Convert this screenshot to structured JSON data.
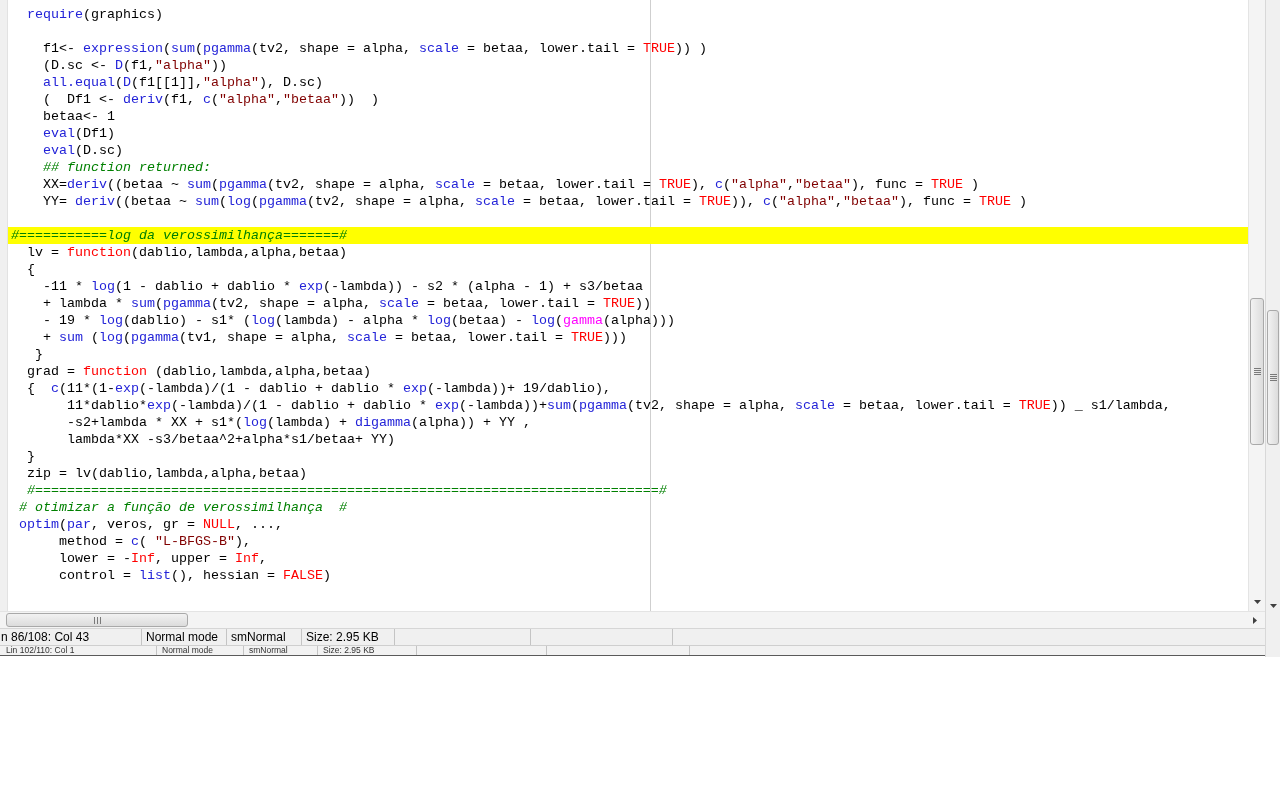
{
  "editor": {
    "lines": [
      {
        "kind": "code",
        "highlighted": false,
        "segments": [
          {
            "kind": "function",
            "text": "  require"
          },
          {
            "kind": "plain",
            "text": "(graphics)"
          }
        ]
      },
      {
        "kind": "blank",
        "highlighted": false
      },
      {
        "kind": "code",
        "highlighted": false,
        "segments": [
          {
            "kind": "plain",
            "text": "    f1<- "
          },
          {
            "kind": "function",
            "text": "expression"
          },
          {
            "kind": "plain",
            "text": "("
          },
          {
            "kind": "function",
            "text": "sum"
          },
          {
            "kind": "plain",
            "text": "("
          },
          {
            "kind": "function",
            "text": "pgamma"
          },
          {
            "kind": "plain",
            "text": "(tv2, shape = alpha, "
          },
          {
            "kind": "function",
            "text": "scale"
          },
          {
            "kind": "plain",
            "text": " = betaa, lower.tail = "
          },
          {
            "kind": "constant",
            "text": "TRUE"
          },
          {
            "kind": "plain",
            "text": ")) )"
          }
        ]
      },
      {
        "kind": "code",
        "highlighted": false,
        "segments": [
          {
            "kind": "plain",
            "text": "    (D.sc <- "
          },
          {
            "kind": "function",
            "text": "D"
          },
          {
            "kind": "plain",
            "text": "(f1,"
          },
          {
            "kind": "string",
            "text": "\"alpha\""
          },
          {
            "kind": "plain",
            "text": "))"
          }
        ]
      },
      {
        "kind": "code",
        "highlighted": false,
        "segments": [
          {
            "kind": "function",
            "text": "    all.equal"
          },
          {
            "kind": "plain",
            "text": "("
          },
          {
            "kind": "function",
            "text": "D"
          },
          {
            "kind": "plain",
            "text": "(f1[[1]],"
          },
          {
            "kind": "string",
            "text": "\"alpha\""
          },
          {
            "kind": "plain",
            "text": "), D.sc)"
          }
        ]
      },
      {
        "kind": "code",
        "highlighted": false,
        "segments": [
          {
            "kind": "plain",
            "text": "    (  Df1 <- "
          },
          {
            "kind": "function",
            "text": "deriv"
          },
          {
            "kind": "plain",
            "text": "(f1, "
          },
          {
            "kind": "function",
            "text": "c"
          },
          {
            "kind": "plain",
            "text": "("
          },
          {
            "kind": "string",
            "text": "\"alpha\""
          },
          {
            "kind": "plain",
            "text": ","
          },
          {
            "kind": "string",
            "text": "\"betaa\""
          },
          {
            "kind": "plain",
            "text": "))  )"
          }
        ]
      },
      {
        "kind": "code",
        "highlighted": false,
        "segments": [
          {
            "kind": "plain",
            "text": "    betaa<- 1"
          }
        ]
      },
      {
        "kind": "code",
        "highlighted": false,
        "segments": [
          {
            "kind": "function",
            "text": "    eval"
          },
          {
            "kind": "plain",
            "text": "(Df1)"
          }
        ]
      },
      {
        "kind": "code",
        "highlighted": false,
        "segments": [
          {
            "kind": "function",
            "text": "    eval"
          },
          {
            "kind": "plain",
            "text": "(D.sc)"
          }
        ]
      },
      {
        "kind": "code",
        "highlighted": false,
        "segments": [
          {
            "kind": "comment",
            "text": "    ## function returned:"
          }
        ]
      },
      {
        "kind": "code",
        "highlighted": false,
        "segments": [
          {
            "kind": "plain",
            "text": "    XX="
          },
          {
            "kind": "function",
            "text": "deriv"
          },
          {
            "kind": "plain",
            "text": "((betaa ~ "
          },
          {
            "kind": "function",
            "text": "sum"
          },
          {
            "kind": "plain",
            "text": "("
          },
          {
            "kind": "function",
            "text": "pgamma"
          },
          {
            "kind": "plain",
            "text": "(tv2, shape = alpha, "
          },
          {
            "kind": "function",
            "text": "scale"
          },
          {
            "kind": "plain",
            "text": " = betaa, lower.tail = "
          },
          {
            "kind": "constant",
            "text": "TRUE"
          },
          {
            "kind": "plain",
            "text": "), "
          },
          {
            "kind": "function",
            "text": "c"
          },
          {
            "kind": "plain",
            "text": "("
          },
          {
            "kind": "string",
            "text": "\"alpha\""
          },
          {
            "kind": "plain",
            "text": ","
          },
          {
            "kind": "string",
            "text": "\"betaa\""
          },
          {
            "kind": "plain",
            "text": "), func = "
          },
          {
            "kind": "constant",
            "text": "TRUE"
          },
          {
            "kind": "plain",
            "text": " )"
          }
        ]
      },
      {
        "kind": "code",
        "highlighted": false,
        "segments": [
          {
            "kind": "plain",
            "text": "    YY= "
          },
          {
            "kind": "function",
            "text": "deriv"
          },
          {
            "kind": "plain",
            "text": "((betaa ~ "
          },
          {
            "kind": "function",
            "text": "sum"
          },
          {
            "kind": "plain",
            "text": "("
          },
          {
            "kind": "function",
            "text": "log"
          },
          {
            "kind": "plain",
            "text": "("
          },
          {
            "kind": "function",
            "text": "pgamma"
          },
          {
            "kind": "plain",
            "text": "(tv2, shape = alpha, "
          },
          {
            "kind": "function",
            "text": "scale"
          },
          {
            "kind": "plain",
            "text": " = betaa, lower.tail = "
          },
          {
            "kind": "constant",
            "text": "TRUE"
          },
          {
            "kind": "plain",
            "text": ")), "
          },
          {
            "kind": "function",
            "text": "c"
          },
          {
            "kind": "plain",
            "text": "("
          },
          {
            "kind": "string",
            "text": "\"alpha\""
          },
          {
            "kind": "plain",
            "text": ","
          },
          {
            "kind": "string",
            "text": "\"betaa\""
          },
          {
            "kind": "plain",
            "text": "), func = "
          },
          {
            "kind": "constant",
            "text": "TRUE"
          },
          {
            "kind": "plain",
            "text": " )"
          }
        ]
      },
      {
        "kind": "blank",
        "highlighted": false
      },
      {
        "kind": "code",
        "highlighted": true,
        "segments": [
          {
            "kind": "comment",
            "text": "#===========log da verossimilhança=======#"
          }
        ]
      },
      {
        "kind": "code",
        "highlighted": false,
        "segments": [
          {
            "kind": "plain",
            "text": "  lv = "
          },
          {
            "kind": "constant",
            "text": "function"
          },
          {
            "kind": "plain",
            "text": "(dablio,lambda,alpha,betaa)"
          }
        ]
      },
      {
        "kind": "code",
        "highlighted": false,
        "segments": [
          {
            "kind": "plain",
            "text": "  {"
          }
        ]
      },
      {
        "kind": "code",
        "highlighted": false,
        "segments": [
          {
            "kind": "plain",
            "text": "    -11 * "
          },
          {
            "kind": "function",
            "text": "log"
          },
          {
            "kind": "plain",
            "text": "(1 - dablio + dablio * "
          },
          {
            "kind": "function",
            "text": "exp"
          },
          {
            "kind": "plain",
            "text": "(-lambda)) - s2 * (alpha - 1) + s3/betaa"
          }
        ]
      },
      {
        "kind": "code",
        "highlighted": false,
        "segments": [
          {
            "kind": "plain",
            "text": "    + lambda * "
          },
          {
            "kind": "function",
            "text": "sum"
          },
          {
            "kind": "plain",
            "text": "("
          },
          {
            "kind": "function",
            "text": "pgamma"
          },
          {
            "kind": "plain",
            "text": "(tv2, shape = alpha, "
          },
          {
            "kind": "function",
            "text": "scale"
          },
          {
            "kind": "plain",
            "text": " = betaa, lower.tail = "
          },
          {
            "kind": "constant",
            "text": "TRUE"
          },
          {
            "kind": "plain",
            "text": "))"
          }
        ]
      },
      {
        "kind": "code",
        "highlighted": false,
        "segments": [
          {
            "kind": "plain",
            "text": "    - 19 * "
          },
          {
            "kind": "function",
            "text": "log"
          },
          {
            "kind": "plain",
            "text": "(dablio) - s1* ("
          },
          {
            "kind": "function",
            "text": "log"
          },
          {
            "kind": "plain",
            "text": "(lambda) - alpha * "
          },
          {
            "kind": "function",
            "text": "log"
          },
          {
            "kind": "plain",
            "text": "(betaa) - "
          },
          {
            "kind": "function",
            "text": "log"
          },
          {
            "kind": "plain",
            "text": "("
          },
          {
            "kind": "special",
            "text": "gamma"
          },
          {
            "kind": "plain",
            "text": "(alpha)))"
          }
        ]
      },
      {
        "kind": "code",
        "highlighted": false,
        "segments": [
          {
            "kind": "plain",
            "text": "    + "
          },
          {
            "kind": "function",
            "text": "sum"
          },
          {
            "kind": "plain",
            "text": " ("
          },
          {
            "kind": "function",
            "text": "log"
          },
          {
            "kind": "plain",
            "text": "("
          },
          {
            "kind": "function",
            "text": "pgamma"
          },
          {
            "kind": "plain",
            "text": "(tv1, shape = alpha, "
          },
          {
            "kind": "function",
            "text": "scale"
          },
          {
            "kind": "plain",
            "text": " = betaa, lower.tail = "
          },
          {
            "kind": "constant",
            "text": "TRUE"
          },
          {
            "kind": "plain",
            "text": ")))"
          }
        ]
      },
      {
        "kind": "code",
        "highlighted": false,
        "segments": [
          {
            "kind": "plain",
            "text": "   }"
          }
        ]
      },
      {
        "kind": "code",
        "highlighted": false,
        "segments": [
          {
            "kind": "plain",
            "text": "  grad = "
          },
          {
            "kind": "constant",
            "text": "function"
          },
          {
            "kind": "plain",
            "text": " (dablio,lambda,alpha,betaa)"
          }
        ]
      },
      {
        "kind": "code",
        "highlighted": false,
        "segments": [
          {
            "kind": "plain",
            "text": "  {  "
          },
          {
            "kind": "function",
            "text": "c"
          },
          {
            "kind": "plain",
            "text": "(11*(1-"
          },
          {
            "kind": "function",
            "text": "exp"
          },
          {
            "kind": "plain",
            "text": "(-lambda)/(1 - dablio + dablio * "
          },
          {
            "kind": "function",
            "text": "exp"
          },
          {
            "kind": "plain",
            "text": "(-lambda))+ 19/dablio),"
          }
        ]
      },
      {
        "kind": "code",
        "highlighted": false,
        "segments": [
          {
            "kind": "plain",
            "text": "       11*dablio*"
          },
          {
            "kind": "function",
            "text": "exp"
          },
          {
            "kind": "plain",
            "text": "(-lambda)/(1 - dablio + dablio * "
          },
          {
            "kind": "function",
            "text": "exp"
          },
          {
            "kind": "plain",
            "text": "(-lambda))+"
          },
          {
            "kind": "function",
            "text": "sum"
          },
          {
            "kind": "plain",
            "text": "("
          },
          {
            "kind": "function",
            "text": "pgamma"
          },
          {
            "kind": "plain",
            "text": "(tv2, shape = alpha, "
          },
          {
            "kind": "function",
            "text": "scale"
          },
          {
            "kind": "plain",
            "text": " = betaa, lower.tail = "
          },
          {
            "kind": "constant",
            "text": "TRUE"
          },
          {
            "kind": "plain",
            "text": ")) _ s1/lambda,"
          }
        ]
      },
      {
        "kind": "code",
        "highlighted": false,
        "segments": [
          {
            "kind": "plain",
            "text": "       -s2+lambda * XX + s1*("
          },
          {
            "kind": "function",
            "text": "log"
          },
          {
            "kind": "plain",
            "text": "(lambda) + "
          },
          {
            "kind": "function",
            "text": "digamma"
          },
          {
            "kind": "plain",
            "text": "(alpha)) + YY ,"
          }
        ]
      },
      {
        "kind": "code",
        "highlighted": false,
        "segments": [
          {
            "kind": "plain",
            "text": "       lambda*XX -s3/betaa^2+alpha*s1/betaa+ YY)"
          }
        ]
      },
      {
        "kind": "code",
        "highlighted": false,
        "segments": [
          {
            "kind": "plain",
            "text": "  }"
          }
        ]
      },
      {
        "kind": "code",
        "highlighted": false,
        "segments": [
          {
            "kind": "plain",
            "text": "  zip = lv(dablio,lambda,alpha,betaa)"
          }
        ]
      },
      {
        "kind": "code",
        "highlighted": false,
        "segments": [
          {
            "kind": "comment",
            "text": "  #==============================================================================#"
          }
        ]
      },
      {
        "kind": "code",
        "highlighted": false,
        "segments": [
          {
            "kind": "comment",
            "text": " # otimizar a função de verossimilhança  #"
          }
        ]
      },
      {
        "kind": "code",
        "highlighted": false,
        "segments": [
          {
            "kind": "function",
            "text": " optim"
          },
          {
            "kind": "plain",
            "text": "("
          },
          {
            "kind": "function",
            "text": "par"
          },
          {
            "kind": "plain",
            "text": ", veros, gr = "
          },
          {
            "kind": "constant",
            "text": "NULL"
          },
          {
            "kind": "plain",
            "text": ", ...,"
          }
        ]
      },
      {
        "kind": "code",
        "highlighted": false,
        "segments": [
          {
            "kind": "plain",
            "text": "      method = "
          },
          {
            "kind": "function",
            "text": "c"
          },
          {
            "kind": "plain",
            "text": "( "
          },
          {
            "kind": "string",
            "text": "\"L-BFGS-B\""
          },
          {
            "kind": "plain",
            "text": "),"
          }
        ]
      },
      {
        "kind": "code",
        "highlighted": false,
        "segments": [
          {
            "kind": "plain",
            "text": "      lower = -"
          },
          {
            "kind": "constant",
            "text": "Inf"
          },
          {
            "kind": "plain",
            "text": ", upper = "
          },
          {
            "kind": "constant",
            "text": "Inf"
          },
          {
            "kind": "plain",
            "text": ","
          }
        ]
      },
      {
        "kind": "code",
        "highlighted": false,
        "segments": [
          {
            "kind": "plain",
            "text": "      control = "
          },
          {
            "kind": "function",
            "text": "list"
          },
          {
            "kind": "plain",
            "text": "(), hessian = "
          },
          {
            "kind": "constant",
            "text": "FALSE"
          },
          {
            "kind": "plain",
            "text": ")"
          }
        ]
      }
    ]
  },
  "status_bar": {
    "cells": [
      "n 86/108: Col 43",
      "Normal mode",
      "smNormal",
      "Size: 2.95 KB"
    ]
  },
  "background_status_bar": {
    "cells": [
      "Lin 102/110: Col 1",
      "Normal mode",
      "smNormal",
      "Size: 2.95 KB"
    ]
  }
}
